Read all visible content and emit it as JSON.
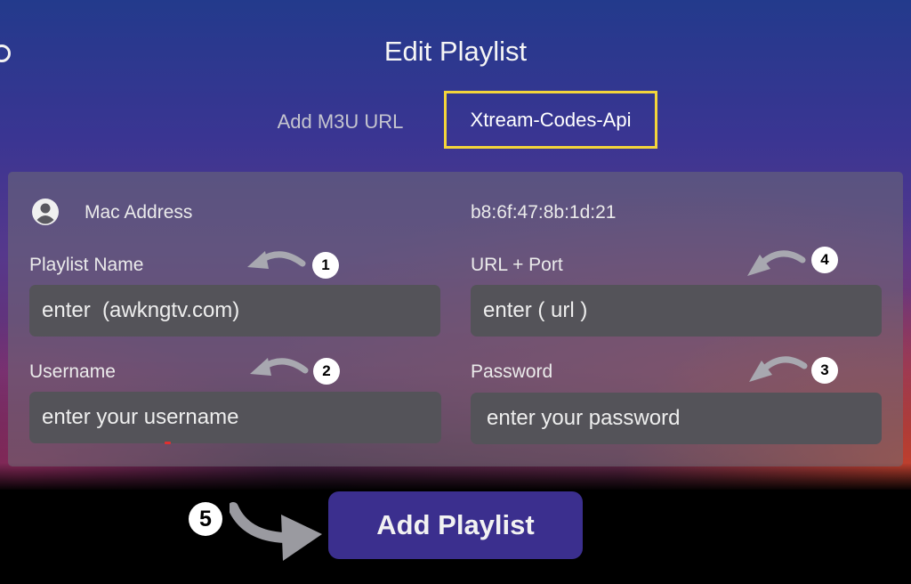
{
  "header": {
    "title": "Edit Playlist"
  },
  "tabs": [
    {
      "label": "Add M3U URL",
      "selected": false
    },
    {
      "label": "Xtream-Codes-Api",
      "selected": true
    }
  ],
  "form": {
    "mac_label": "Mac Address",
    "mac_value": "b8:6f:47:8b:1d:21",
    "playlist_name_label": "Playlist Name",
    "playlist_name_value": "enter  (awkngtv.com)",
    "url_label": "URL + Port",
    "url_value": "enter ( url )",
    "username_label": "Username",
    "username_value": "enter your username",
    "password_label": "Password",
    "password_value": "enter your password"
  },
  "steps": [
    "1",
    "2",
    "3",
    "4",
    "5"
  ],
  "actions": {
    "add_playlist_label": "Add Playlist"
  },
  "colors": {
    "tab_highlight": "#f4d53b",
    "button_bg": "#3b2f8e",
    "field_bg": "#545359"
  },
  "icons": {
    "mac": "user-circle-icon",
    "step_pointer": "curved-arrow-icon"
  }
}
